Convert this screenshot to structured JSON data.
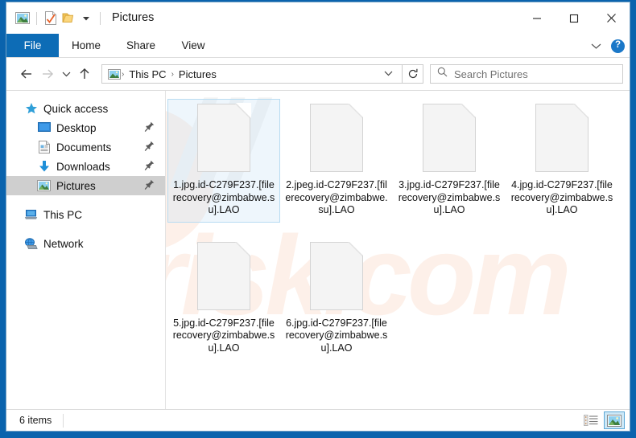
{
  "window": {
    "title": "Pictures",
    "quick_access_toolbar": [
      {
        "name": "pictures-folder-icon",
        "label": "Pictures"
      },
      {
        "name": "properties-icon",
        "label": "Properties"
      },
      {
        "name": "new-folder-icon",
        "label": "New folder"
      },
      {
        "name": "customize-qat-icon",
        "label": "Customize Quick Access Toolbar"
      }
    ],
    "controls": {
      "minimize": "—",
      "maximize": "□",
      "close": "✕"
    }
  },
  "ribbon": {
    "tabs": [
      {
        "label": "File",
        "active": true
      },
      {
        "label": "Home",
        "active": false
      },
      {
        "label": "Share",
        "active": false
      },
      {
        "label": "View",
        "active": false
      }
    ],
    "expand_label": "⌄",
    "help_label": "?"
  },
  "navbar": {
    "back": "←",
    "forward": "→",
    "recent": "⌄",
    "up": "↑",
    "breadcrumb": [
      {
        "label": "This PC"
      },
      {
        "label": "Pictures"
      }
    ],
    "breadcrumb_separator": "›",
    "address_dropdown": "⌄",
    "refresh": "↻"
  },
  "search": {
    "placeholder": "Search Pictures",
    "value": ""
  },
  "sidebar": {
    "items": [
      {
        "label": "Quick access",
        "icon": "star-icon",
        "child": false,
        "pinned": false,
        "selected": false
      },
      {
        "label": "Desktop",
        "icon": "desktop-icon",
        "child": true,
        "pinned": true,
        "selected": false
      },
      {
        "label": "Documents",
        "icon": "documents-icon",
        "child": true,
        "pinned": true,
        "selected": false
      },
      {
        "label": "Downloads",
        "icon": "downloads-icon",
        "child": true,
        "pinned": true,
        "selected": false
      },
      {
        "label": "Pictures",
        "icon": "pictures-icon",
        "child": true,
        "pinned": true,
        "selected": true
      },
      {
        "label": "This PC",
        "icon": "this-pc-icon",
        "child": false,
        "pinned": false,
        "selected": false
      },
      {
        "label": "Network",
        "icon": "network-icon",
        "child": false,
        "pinned": false,
        "selected": false
      }
    ]
  },
  "files": [
    {
      "name": "1.jpg.id-C279F237.[filerecovery@zimbabwe.su].LAO",
      "selected": true
    },
    {
      "name": "2.jpeg.id-C279F237.[filerecovery@zimbabwe.su].LAO",
      "selected": false
    },
    {
      "name": "3.jpg.id-C279F237.[filerecovery@zimbabwe.su].LAO",
      "selected": false
    },
    {
      "name": "4.jpg.id-C279F237.[filerecovery@zimbabwe.su].LAO",
      "selected": false
    },
    {
      "name": "5.jpg.id-C279F237.[filerecovery@zimbabwe.su].LAO",
      "selected": false
    },
    {
      "name": "6.jpg.id-C279F237.[filerecovery@zimbabwe.su].LAO",
      "selected": false
    }
  ],
  "statusbar": {
    "item_count": "6 items",
    "views": [
      {
        "name": "details-view-button",
        "active": false
      },
      {
        "name": "large-icons-view-button",
        "active": true
      }
    ]
  },
  "watermark": {
    "text": "risk.com"
  },
  "colors": {
    "accent": "#0d6cb6",
    "desktop": "#0a63ad",
    "selection_border": "#b8dcf2",
    "selection_fill": "#cde8f7",
    "sidebar_selected": "#cfcfcf"
  }
}
